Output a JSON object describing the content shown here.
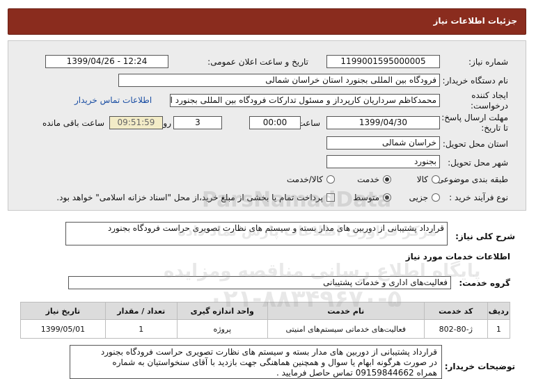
{
  "header": {
    "title": "جزئیات اطلاعات نیاز"
  },
  "fields": {
    "need_number_label": "شماره نیاز:",
    "need_number": "1199001595000005",
    "announce_label": "تاریخ و ساعت اعلان عمومی:",
    "announce_value": "1399/04/26 - 12:24",
    "buyer_label": "نام دستگاه خریدار:",
    "buyer_value": "فرودگاه بین المللی بجنورد استان خراسان شمالی",
    "creator_label1": "ایجاد کننده",
    "creator_label2": "درخواست:",
    "creator_value": "محمدکاظم سرداریان کارپرداز و مسئول تدارکات فرودگاه بین المللی بجنورد استان",
    "contact_link": "اطلاعات تماس خریدار",
    "deadline_label1": "مهلت ارسال پاسخ:",
    "deadline_label2": "تا تاریخ:",
    "deadline_date": "1399/04/30",
    "time_label": "ساعت",
    "deadline_time": "00:00",
    "days_value": "3",
    "days_label": "روز و",
    "remaining_time": "09:51:59",
    "remaining_label": "ساعت باقی مانده",
    "province_label": "استان محل تحویل:",
    "province_value": "خراسان شمالی",
    "city_label": "شهر محل تحویل:",
    "city_value": "بجنورد",
    "category_label": "طبقه بندی موضوعی:",
    "category_options": [
      "کالا",
      "خدمت",
      "کالا/خدمت"
    ],
    "process_label": "نوع فرآیند خرید :",
    "process_options": [
      "جزیی",
      "متوسط"
    ],
    "payment_text": "پرداخت تمام یا بخشی از مبلغ خرید،از محل \"اسناد خزانه اسلامی\" خواهد بود."
  },
  "summary": {
    "label": "شرح کلی نیاز:",
    "value": "قرارداد پشتیبانی از دوربین های مدار بسته و سیستم های نظارت تصویری حراست فرودگاه بجنورد"
  },
  "services": {
    "section_title": "اطلاعات خدمات مورد نیاز",
    "group_label": "گروه خدمت:",
    "group_value": "فعالیت‌های اداری و خدمات پشتیبانی",
    "columns": [
      "ردیف",
      "کد خدمت",
      "نام خدمت",
      "واحد اندازه گیری",
      "تعداد / مقدار",
      "تاریخ نیاز"
    ],
    "rows": [
      {
        "row": "1",
        "code": "ژ-80-802",
        "name": "فعالیت‌های خدماتی سیستم‌های امنیتی",
        "unit": "پروژه",
        "qty": "1",
        "date": "1399/05/01"
      }
    ]
  },
  "notes": {
    "label": "توضیحات خریدار:",
    "lines": [
      "قرارداد پشتیبانی از دوربین های مدار بسته و سیستم های نظارت تصویری حراست فرودگاه بجنورد",
      "در صورت هرگونه ابهام یا سوال و همچنین هماهنگی جهت بازدید با آقای سنخواستیان به شماره",
      "همراه 09159844662 تماس حاصل فرمایید ."
    ]
  },
  "watermark": {
    "line1": "ParsNamadData",
    "line2": "مرکز فراوری اطلاعات پارس نماد داده",
    "line3": "پایگاه اطلاع رسانی مناقصه ومزایده",
    "line4": "۰۲۱-۸۸۳۴۹۶۷۰-۵"
  }
}
